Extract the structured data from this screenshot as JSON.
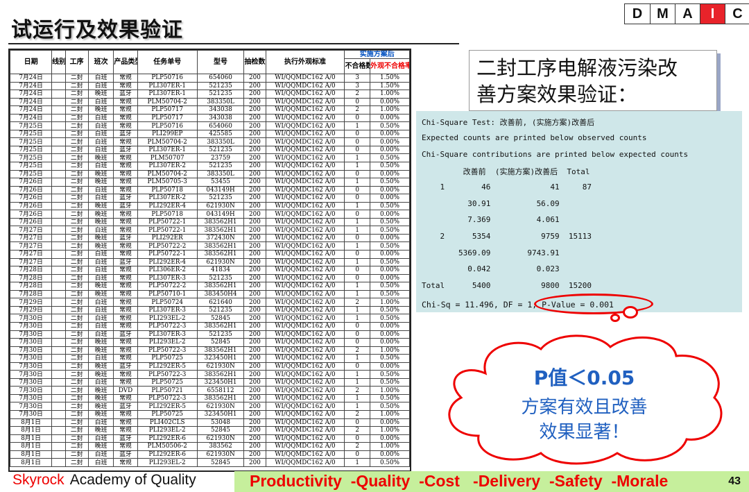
{
  "title": "试运行及效果验证",
  "dmaic": [
    "D",
    "M",
    "A",
    "I",
    "C"
  ],
  "dmaic_active": "I",
  "table": {
    "plan_header": "实施方案后",
    "headers": [
      "日期",
      "线别",
      "工序",
      "班次",
      "产品类型",
      "任务单号",
      "型号",
      "抽检数",
      "执行外观标准",
      "不合格数",
      "外观不合格率"
    ],
    "rows": [
      [
        "7月24日",
        "",
        "二封",
        "白班",
        "常规",
        "PLP50716",
        "654060",
        "200",
        "WI/QQMDC162 A/0",
        "3",
        "1.50%"
      ],
      [
        "7月24日",
        "",
        "二封",
        "白班",
        "常规",
        "PLI307ER-1",
        "521235",
        "200",
        "WI/QQMDC162 A/0",
        "3",
        "1.50%"
      ],
      [
        "7月24日",
        "",
        "二封",
        "晚班",
        "蓝牙",
        "PLI307ER-1",
        "521235",
        "200",
        "WI/QQMDC162 A/0",
        "2",
        "1.00%"
      ],
      [
        "7月24日",
        "",
        "二封",
        "白班",
        "常规",
        "PLM50704-2",
        "383350L",
        "200",
        "WI/QQMDC162 A/0",
        "0",
        "0.00%"
      ],
      [
        "7月24日",
        "",
        "二封",
        "晚班",
        "常规",
        "PLP50717",
        "343038",
        "200",
        "WI/QQMDC162 A/0",
        "2",
        "1.00%"
      ],
      [
        "7月24日",
        "",
        "二封",
        "白班",
        "常规",
        "PLP50717",
        "343038",
        "200",
        "WI/QQMDC162 A/0",
        "0",
        "0.00%"
      ],
      [
        "7月25日",
        "",
        "二封",
        "白班",
        "常规",
        "PLP50716",
        "654060",
        "200",
        "WI/QQMDC162 A/0",
        "1",
        "0.50%"
      ],
      [
        "7月25日",
        "",
        "二封",
        "白班",
        "蓝牙",
        "PLI299EP",
        "425585",
        "200",
        "WI/QQMDC162 A/0",
        "0",
        "0.00%"
      ],
      [
        "7月25日",
        "",
        "二封",
        "白班",
        "常规",
        "PLM50704-2",
        "383350L",
        "200",
        "WI/QQMDC162 A/0",
        "0",
        "0.00%"
      ],
      [
        "7月25日",
        "",
        "二封",
        "白班",
        "蓝牙",
        "PLI307ER-1",
        "521235",
        "200",
        "WI/QQMDC162 A/0",
        "0",
        "0.00%"
      ],
      [
        "7月25日",
        "",
        "二封",
        "晚班",
        "常规",
        "PLM50707",
        "23759",
        "200",
        "WI/QQMDC162 A/0",
        "1",
        "0.50%"
      ],
      [
        "7月25日",
        "",
        "二封",
        "白班",
        "常规",
        "PLI307ER-2",
        "521235",
        "200",
        "WI/QQMDC162 A/0",
        "1",
        "0.50%"
      ],
      [
        "7月25日",
        "",
        "二封",
        "晚班",
        "常规",
        "PLM50704-2",
        "383350L",
        "200",
        "WI/QQMDC162 A/0",
        "0",
        "0.00%"
      ],
      [
        "7月26日",
        "",
        "二封",
        "晚班",
        "常规",
        "PLM50705-3",
        "53455",
        "200",
        "WI/QQMDC162 A/0",
        "1",
        "0.50%"
      ],
      [
        "7月26日",
        "",
        "二封",
        "白班",
        "常规",
        "PLP50718",
        "043149H",
        "200",
        "WI/QQMDC162 A/0",
        "0",
        "0.00%"
      ],
      [
        "7月26日",
        "",
        "二封",
        "白班",
        "蓝牙",
        "PLI307ER-2",
        "521235",
        "200",
        "WI/QQMDC162 A/0",
        "0",
        "0.00%"
      ],
      [
        "7月26日",
        "",
        "二封",
        "晚班",
        "蓝牙",
        "PLI292ER-4",
        "621930N",
        "200",
        "WI/QQMDC162 A/0",
        "1",
        "0.50%"
      ],
      [
        "7月26日",
        "",
        "二封",
        "晚班",
        "常规",
        "PLP50718",
        "043149H",
        "200",
        "WI/QQMDC162 A/0",
        "0",
        "0.00%"
      ],
      [
        "7月26日",
        "",
        "二封",
        "晚班",
        "常规",
        "PLP50722-1",
        "383562H1",
        "200",
        "WI/QQMDC162 A/0",
        "1",
        "0.50%"
      ],
      [
        "7月27日",
        "",
        "二封",
        "白班",
        "常规",
        "PLP50722-1",
        "383562H1",
        "200",
        "WI/QQMDC162 A/0",
        "1",
        "0.50%"
      ],
      [
        "7月27日",
        "",
        "二封",
        "晚班",
        "蓝牙",
        "PLI292ER",
        "372430N",
        "200",
        "WI/QQMDC162 A/0",
        "0",
        "0.00%"
      ],
      [
        "7月27日",
        "",
        "二封",
        "晚班",
        "常规",
        "PLP50722-2",
        "383562H1",
        "200",
        "WI/QQMDC162 A/0",
        "1",
        "0.50%"
      ],
      [
        "7月27日",
        "",
        "二封",
        "白班",
        "常规",
        "PLP50722-1",
        "383562H1",
        "200",
        "WI/QQMDC162 A/0",
        "0",
        "0.00%"
      ],
      [
        "7月27日",
        "",
        "二封",
        "白班",
        "蓝牙",
        "PLI292ER-4",
        "621930N",
        "200",
        "WI/QQMDC162 A/0",
        "1",
        "0.50%"
      ],
      [
        "7月28日",
        "",
        "二封",
        "白班",
        "常规",
        "PLI306ER-2",
        "41834",
        "200",
        "WI/QQMDC162 A/0",
        "0",
        "0.00%"
      ],
      [
        "7月28日",
        "",
        "二封",
        "白班",
        "常规",
        "PLI307ER-3",
        "521235",
        "200",
        "WI/QQMDC162 A/0",
        "0",
        "0.00%"
      ],
      [
        "7月28日",
        "",
        "二封",
        "晚班",
        "常规",
        "PLP50722-2",
        "383562H1",
        "200",
        "WI/QQMDC162 A/0",
        "1",
        "0.50%"
      ],
      [
        "7月28日",
        "",
        "二封",
        "晚班",
        "常规",
        "PLP50710-1",
        "383450H4",
        "200",
        "WI/QQMDC162 A/0",
        "1",
        "0.50%"
      ],
      [
        "7月29日",
        "",
        "二封",
        "白班",
        "常规",
        "PLP50724",
        "621640",
        "200",
        "WI/QQMDC162 A/0",
        "2",
        "1.00%"
      ],
      [
        "7月29日",
        "",
        "二封",
        "白班",
        "常规",
        "PLI307ER-3",
        "521235",
        "200",
        "WI/QQMDC162 A/0",
        "1",
        "0.50%"
      ],
      [
        "7月30日",
        "",
        "二封",
        "白班",
        "常规",
        "PLI293EL-2",
        "52845",
        "200",
        "WI/QQMDC162 A/0",
        "1",
        "0.50%"
      ],
      [
        "7月30日",
        "",
        "二封",
        "白班",
        "常规",
        "PLP50722-3",
        "383562H1",
        "200",
        "WI/QQMDC162 A/0",
        "0",
        "0.00%"
      ],
      [
        "7月30日",
        "",
        "二封",
        "白班",
        "蓝牙",
        "PLI307ER-3",
        "521235",
        "200",
        "WI/QQMDC162 A/0",
        "0",
        "0.00%"
      ],
      [
        "7月30日",
        "",
        "二封",
        "晚班",
        "常规",
        "PLI293EL-2",
        "52845",
        "200",
        "WI/QQMDC162 A/0",
        "0",
        "0.00%"
      ],
      [
        "7月30日",
        "",
        "二封",
        "晚班",
        "常规",
        "PLP50722-3",
        "383562H1",
        "200",
        "WI/QQMDC162 A/0",
        "2",
        "1.00%"
      ],
      [
        "7月30日",
        "",
        "二封",
        "白班",
        "常规",
        "PLP50725",
        "323450H1",
        "200",
        "WI/QQMDC162 A/0",
        "1",
        "0.50%"
      ],
      [
        "7月30日",
        "",
        "二封",
        "晚班",
        "蓝牙",
        "PLI292ER-5",
        "621930N",
        "200",
        "WI/QQMDC162 A/0",
        "0",
        "0.00%"
      ],
      [
        "7月30日",
        "",
        "二封",
        "晚班",
        "常规",
        "PLP50722-3",
        "383562H1",
        "200",
        "WI/QQMDC162 A/0",
        "1",
        "0.50%"
      ],
      [
        "7月30日",
        "",
        "二封",
        "白班",
        "常规",
        "PLP50725",
        "323450H1",
        "200",
        "WI/QQMDC162 A/0",
        "1",
        "0.50%"
      ],
      [
        "7月30日",
        "",
        "二封",
        "晚班",
        "DVD",
        "PLP50721",
        "6558112",
        "200",
        "WI/QQMDC162 A/0",
        "2",
        "1.00%"
      ],
      [
        "7月30日",
        "",
        "二封",
        "晚班",
        "常规",
        "PLP50722-3",
        "383562H1",
        "200",
        "WI/QQMDC162 A/0",
        "1",
        "0.50%"
      ],
      [
        "7月30日",
        "",
        "二封",
        "晚班",
        "蓝牙",
        "PLI292ER-5",
        "621930N",
        "200",
        "WI/QQMDC162 A/0",
        "1",
        "0.50%"
      ],
      [
        "7月30日",
        "",
        "二封",
        "晚班",
        "常规",
        "PLP50725",
        "323450H1",
        "200",
        "WI/QQMDC162 A/0",
        "2",
        "1.00%"
      ],
      [
        "8月1日",
        "",
        "二封",
        "白班",
        "常规",
        "PLI402CLS",
        "53048",
        "200",
        "WI/QQMDC162 A/0",
        "0",
        "0.00%"
      ],
      [
        "8月1日",
        "",
        "二封",
        "晚班",
        "常规",
        "PLI293EL-2",
        "52845",
        "200",
        "WI/QQMDC162 A/0",
        "2",
        "1.00%"
      ],
      [
        "8月1日",
        "",
        "二封",
        "白班",
        "蓝牙",
        "PLI292ER-6",
        "621930N",
        "200",
        "WI/QQMDC162 A/0",
        "0",
        "0.00%"
      ],
      [
        "8月1日",
        "",
        "二封",
        "晚班",
        "常规",
        "PLM50506-2",
        "383562",
        "200",
        "WI/QQMDC162 A/0",
        "2",
        "1.00%"
      ],
      [
        "8月1日",
        "",
        "二封",
        "白班",
        "蓝牙",
        "PLI292ER-6",
        "621930N",
        "200",
        "WI/QQMDC162 A/0",
        "0",
        "0.00%"
      ],
      [
        "8月1日",
        "",
        "二封",
        "白班",
        "常规",
        "PLI293EL-2",
        "52845",
        "200",
        "WI/QQMDC162 A/0",
        "1",
        "0.50%"
      ]
    ]
  },
  "question_box": {
    "line1": "二封工序电解液污染改",
    "line2": "善方案效果验证："
  },
  "minitab": {
    "lines": [
      "Chi-Square Test: 改善前, (实施方案)改善后",
      "Expected counts are printed below observed counts",
      "Chi-Square contributions are printed below expected counts",
      "         改善前  (实施方案)改善后  Total",
      "    1        46             41     87",
      "          30.91          56.09",
      "          7.369          4.061",
      "    2      5354           9759  15113",
      "        5369.09        9743.91",
      "          0.042          0.023",
      "Total      5400           9800  15200",
      "Chi-Sq = 11.496, DF = 1, P-Value = 0.001"
    ]
  },
  "cloud": {
    "line1": "P值＜0.05",
    "line2": "方案有效且改善",
    "line3": "效果显著！"
  },
  "footer": {
    "brand": "Skyrock",
    "academy": "Academy of Quality",
    "pqcdsm": "Productivity  -Quality  -Cost   -Delivery  -Safety  -Morale",
    "page": "43"
  }
}
